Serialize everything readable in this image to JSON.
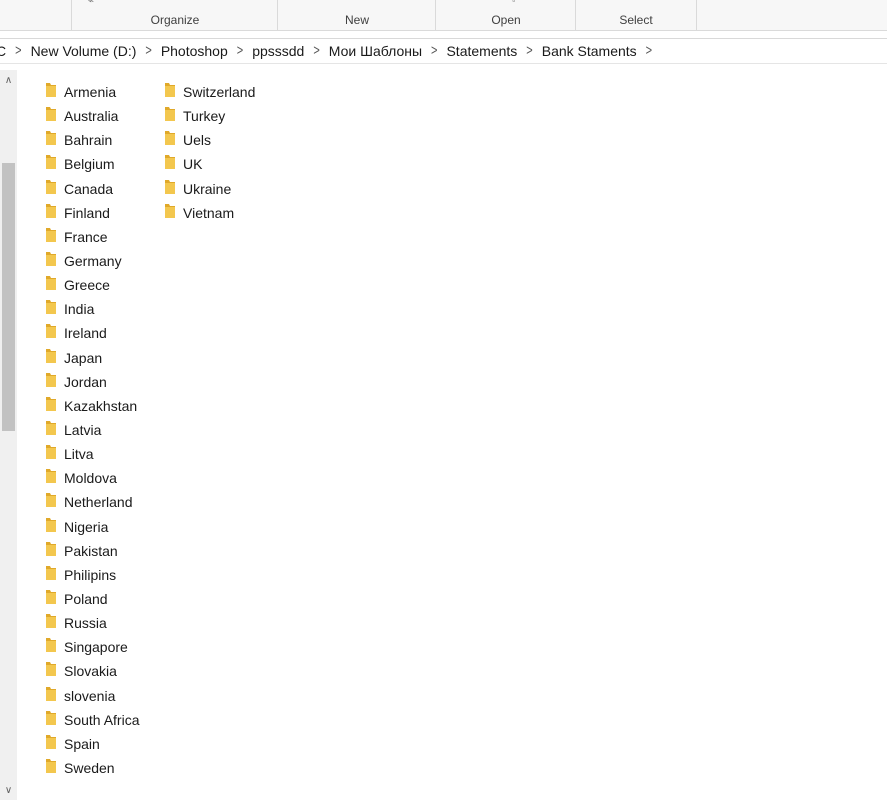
{
  "ribbon": {
    "groups": [
      {
        "label": "Organize"
      },
      {
        "label": "New"
      },
      {
        "label": "Open"
      },
      {
        "label": "Select"
      }
    ]
  },
  "address": {
    "crumbs": [
      "C",
      "New Volume (D:)",
      "Photoshop",
      "ppsssdd",
      "Мои Шаблоны",
      "Statements",
      "Bank Staments"
    ]
  },
  "colors": {
    "folder": "#f3c74e",
    "folder_dark": "#e0a92a"
  },
  "folders": {
    "col1": [
      "Armenia",
      "Australia",
      "Bahrain",
      "Belgium",
      "Canada",
      "Finland",
      "France",
      "Germany",
      "Greece",
      "India",
      "Ireland",
      "Japan",
      "Jordan",
      "Kazakhstan",
      "Latvia",
      "Litva",
      "Moldova",
      "Netherland",
      "Nigeria",
      "Pakistan",
      "Philipins",
      "Poland",
      "Russia",
      "Singapore",
      "Slovakia",
      "slovenia",
      "South Africa",
      "Spain",
      "Sweden"
    ],
    "col2": [
      "Switzerland",
      "Turkey",
      "Uels",
      "UK",
      "Ukraine",
      "Vietnam"
    ]
  }
}
